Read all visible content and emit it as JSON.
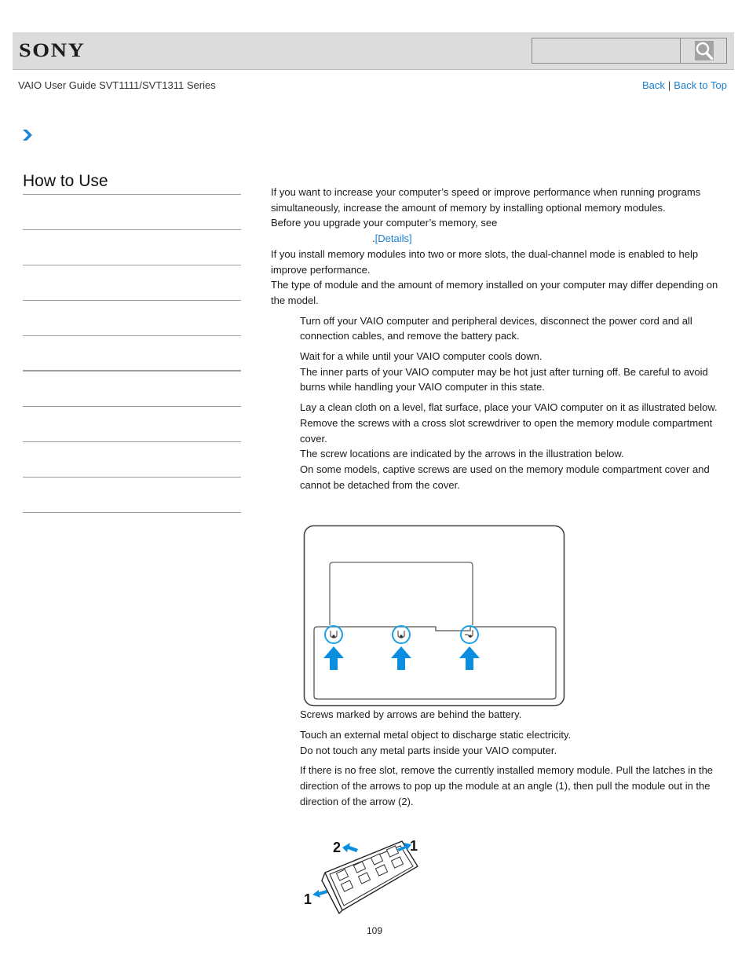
{
  "header": {
    "logo": "SONY",
    "search": {
      "value": "",
      "placeholder": ""
    },
    "search_icon": "magnifier-icon"
  },
  "subheader": {
    "guide_title": "VAIO User Guide SVT1111/SVT1311 Series",
    "back_label": "Back",
    "separator": "|",
    "back_to_top_label": "Back to Top"
  },
  "breadcrumb": {
    "icon": "chevron-right-icon"
  },
  "sidebar": {
    "title": "How to Use",
    "items": [
      {
        "label": ""
      },
      {
        "label": ""
      },
      {
        "label": ""
      },
      {
        "label": ""
      },
      {
        "label": ""
      },
      {
        "label": ""
      },
      {
        "label": ""
      },
      {
        "label": ""
      },
      {
        "label": ""
      }
    ]
  },
  "main": {
    "intro": [
      "If you want to increase your computer’s speed or improve performance when running programs simultaneously, increase the amount of memory by installing optional memory modules.",
      "Before you upgrade your computer’s memory, see"
    ],
    "details_prefix": ".",
    "details_link": "[Details]",
    "notes": [
      "If you install memory modules into two or more slots, the dual-channel mode is enabled to help improve performance.",
      "The type of module and the amount of memory installed on your computer may differ depending on the model."
    ],
    "steps": [
      [
        "Turn off your VAIO computer and peripheral devices, disconnect the power cord and all connection cables, and remove the battery pack."
      ],
      [
        "Wait for a while until your VAIO computer cools down.",
        "The inner parts of your VAIO computer may be hot just after turning off. Be careful to avoid burns while handling your VAIO computer in this state."
      ],
      [
        "Lay a clean cloth on a level, flat surface, place your VAIO computer on it as illustrated below. Remove the screws with a cross slot screwdriver to open the memory module compartment cover.",
        "The screw locations are indicated by the arrows in the illustration below.",
        "On some models, captive screws are used on the memory module compartment cover and cannot be detached from the cover."
      ]
    ],
    "figure1_caption": "Screws marked by arrows are behind the battery.",
    "steps_after": [
      [
        "Touch an external metal object to discharge static electricity.",
        "Do not touch any metal parts inside your VAIO computer."
      ],
      [
        "If there is no free slot, remove the currently installed memory module. Pull the latches in the direction of the arrows to pop up the module at an angle (1), then pull the module out in the direction of the arrow (2)."
      ]
    ],
    "figure2_labels": {
      "latch_left": "1",
      "latch_right": "1",
      "pull_out": "2"
    }
  },
  "colors": {
    "accent": "#1a7fd0",
    "arrow_blue": "#0a8ee0",
    "header_bg": "#dcdcdc",
    "divider": "#a0a0a0"
  },
  "footer": {
    "page_number": "109"
  }
}
